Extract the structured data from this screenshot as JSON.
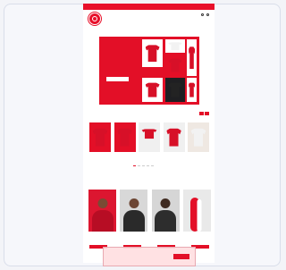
{
  "topbar": {
    "items": [
      "",
      "",
      "",
      ""
    ]
  },
  "navigation": {
    "items": [
      "",
      "",
      "",
      "",
      "",
      "",
      "",
      ""
    ]
  },
  "hero": {
    "title": "",
    "subtitle": "",
    "button": ""
  },
  "sections": {
    "products_title": "",
    "gallery_title": "",
    "bottom_title": ""
  },
  "product_captions": [
    "",
    "",
    "",
    "",
    "",
    ""
  ],
  "colors": {
    "brand": "#e30f27",
    "page": "#ffffff",
    "background": "#f3f4f8"
  },
  "icons": [
    "logo-icon",
    "search-icon",
    "account-icon",
    "cart-icon",
    "arrow-left-icon",
    "arrow-right-icon"
  ]
}
